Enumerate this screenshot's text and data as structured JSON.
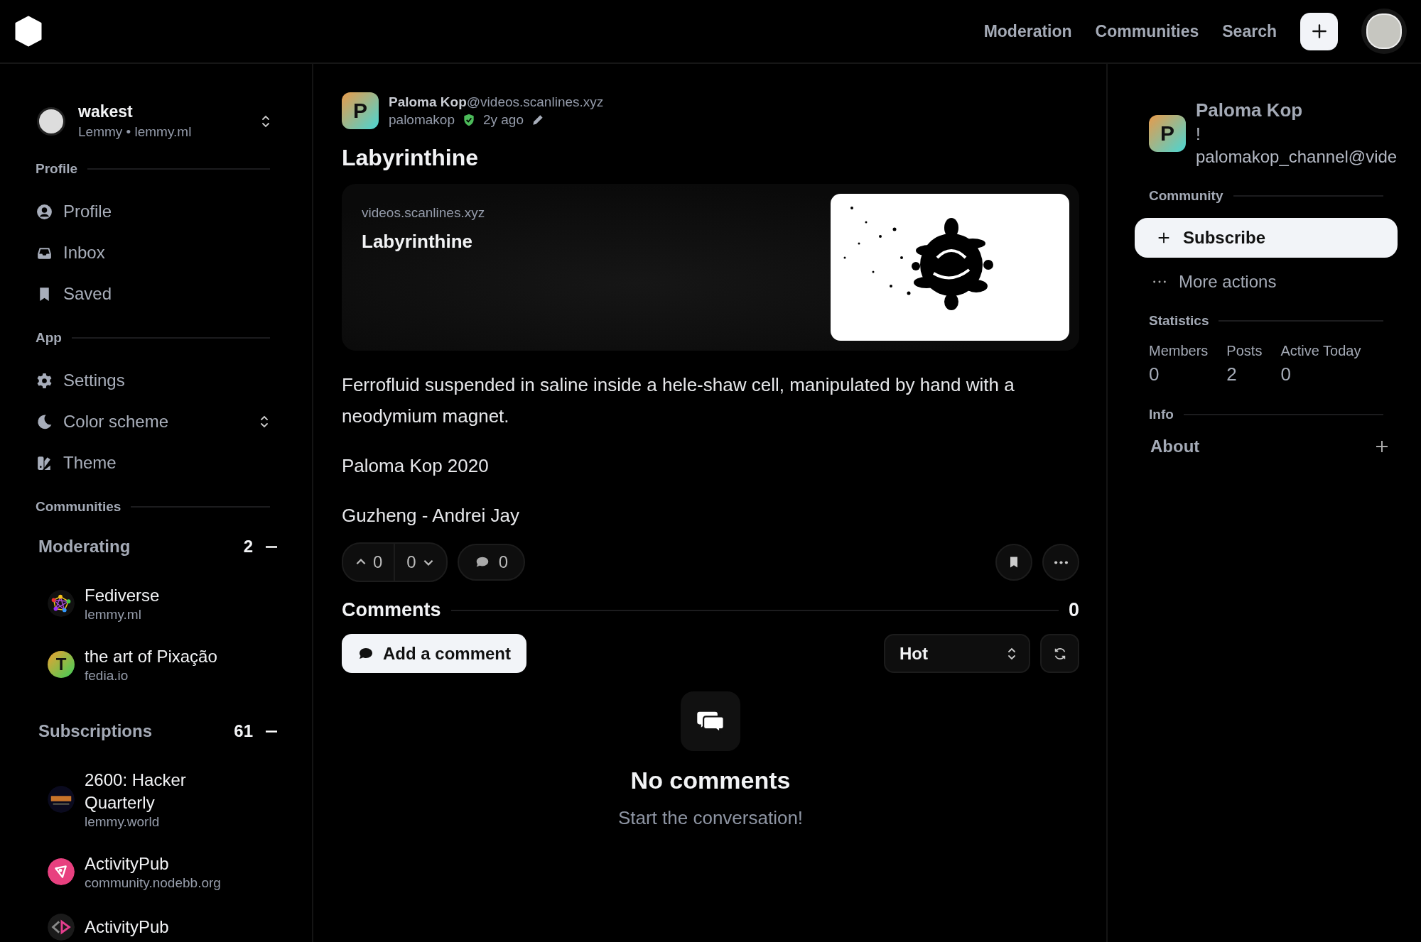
{
  "topbar": {
    "nav": [
      "Moderation",
      "Communities",
      "Search"
    ]
  },
  "account": {
    "name": "wakest",
    "instance": "Lemmy • lemmy.ml"
  },
  "sidebar": {
    "sections": [
      {
        "title": "Profile",
        "items": [
          {
            "label": "Profile",
            "kind": "user",
            "expandable": false
          },
          {
            "label": "Inbox",
            "kind": "inbox",
            "expandable": false
          },
          {
            "label": "Saved",
            "kind": "bookmark",
            "expandable": false
          }
        ]
      },
      {
        "title": "App",
        "items": [
          {
            "label": "Settings",
            "kind": "gear",
            "expandable": false
          },
          {
            "label": "Color scheme",
            "kind": "moon",
            "expandable": true
          },
          {
            "label": "Theme",
            "kind": "palette",
            "expandable": false
          }
        ]
      }
    ]
  },
  "communities": {
    "title": "Communities",
    "groups": [
      {
        "title": "Moderating",
        "count": "2",
        "expanded": true,
        "items": [
          {
            "name": "Fediverse",
            "instance": "lemmy.ml",
            "kind": "fediverse"
          },
          {
            "name": "the art of Pixação",
            "instance": "fedia.io",
            "kind": "letter",
            "letter": "T"
          }
        ]
      },
      {
        "title": "Subscriptions",
        "count": "61",
        "expanded": true,
        "items": [
          {
            "name": "2600: Hacker Quarterly",
            "instance": "lemmy.world",
            "kind": "emblem"
          },
          {
            "name": "ActivityPub",
            "instance": "community.nodebb.org",
            "kind": "activitypub"
          },
          {
            "name": "ActivityPub",
            "kind": "chevrons"
          }
        ]
      }
    ]
  },
  "post": {
    "author": {
      "letter": "P",
      "name": "Paloma Kop",
      "instance": "@videos.scanlines.xyz",
      "username": "palomakop",
      "verified": true,
      "time": "2y ago"
    },
    "title": "Labyrinthine",
    "link": {
      "domain": "videos.scanlines.xyz",
      "title": "Labyrinthine"
    },
    "body": [
      "Ferrofluid suspended in saline inside a hele-shaw cell, manipulated by hand with a neodymium magnet.",
      "Paloma Kop 2020",
      "Guzheng - Andrei Jay"
    ],
    "upvotes": "0",
    "downvotes": "0",
    "comment_count": "0"
  },
  "comments": {
    "title": "Comments",
    "count": "0",
    "add_label": "Add a comment",
    "sort": "Hot",
    "empty_title": "No comments",
    "empty_text": "Start the conversation!"
  },
  "community": {
    "letter": "P",
    "name": "Paloma Kop",
    "prefix": "!",
    "handle": "palomakop_channel@vide",
    "section_title": "Community",
    "subscribe": "Subscribe",
    "more": "More actions",
    "statistics_title": "Statistics",
    "stats": [
      {
        "label": "Members",
        "value": "0"
      },
      {
        "label": "Posts",
        "value": "2"
      },
      {
        "label": "Active Today",
        "value": "0"
      }
    ],
    "info_title": "Info",
    "about": "About"
  }
}
